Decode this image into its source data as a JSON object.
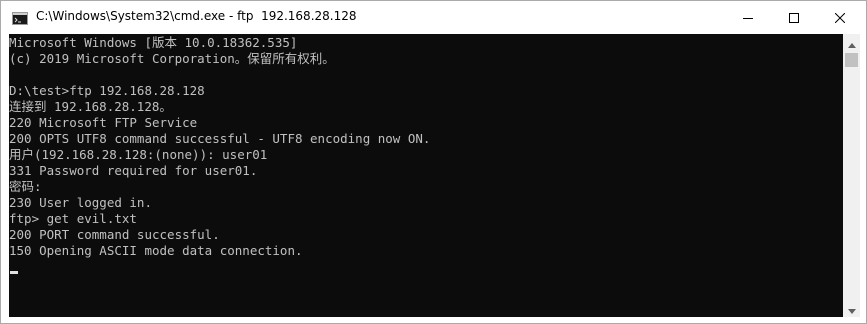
{
  "window": {
    "title": "C:\\Windows\\System32\\cmd.exe - ftp  192.168.28.128",
    "icon": "cmd-icon",
    "controls": [
      "minimize-icon",
      "maximize-icon",
      "close-icon"
    ]
  },
  "console": {
    "lines": [
      "Microsoft Windows [版本 10.0.18362.535]",
      "(c) 2019 Microsoft Corporation。保留所有权利。",
      "",
      "D:\\test>ftp 192.168.28.128",
      "连接到 192.168.28.128。",
      "220 Microsoft FTP Service",
      "200 OPTS UTF8 command successful - UTF8 encoding now ON.",
      "用户(192.168.28.128:(none)): user01",
      "331 Password required for user01.",
      "密码:",
      "230 User logged in.",
      "ftp> get evil.txt",
      "200 PORT command successful.",
      "150 Opening ASCII mode data connection."
    ]
  },
  "colors": {
    "console_bg": "#0c0c0c",
    "console_fg": "#c0c0c0",
    "titlebar_bg": "#ffffff"
  }
}
